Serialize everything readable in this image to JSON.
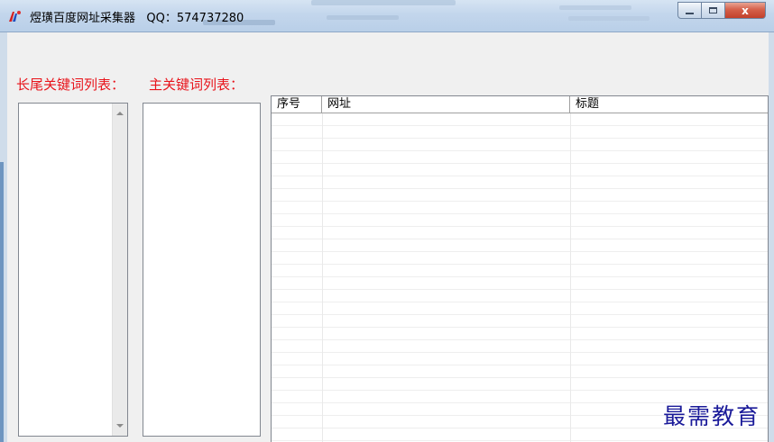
{
  "window": {
    "title": "煜璜百度网址采集器   QQ：574737280",
    "controls": {
      "minimize": "",
      "maximize": "",
      "close": "x"
    }
  },
  "labels": {
    "long_tail_keywords": "长尾关键词列表：",
    "main_keywords": "主关键词列表："
  },
  "results_table": {
    "columns": [
      "序号",
      "网址",
      "标题"
    ],
    "rows": []
  },
  "watermark": "最需教育",
  "colors": {
    "label_red": "#e8141b",
    "watermark_blue": "#1a1a99"
  }
}
